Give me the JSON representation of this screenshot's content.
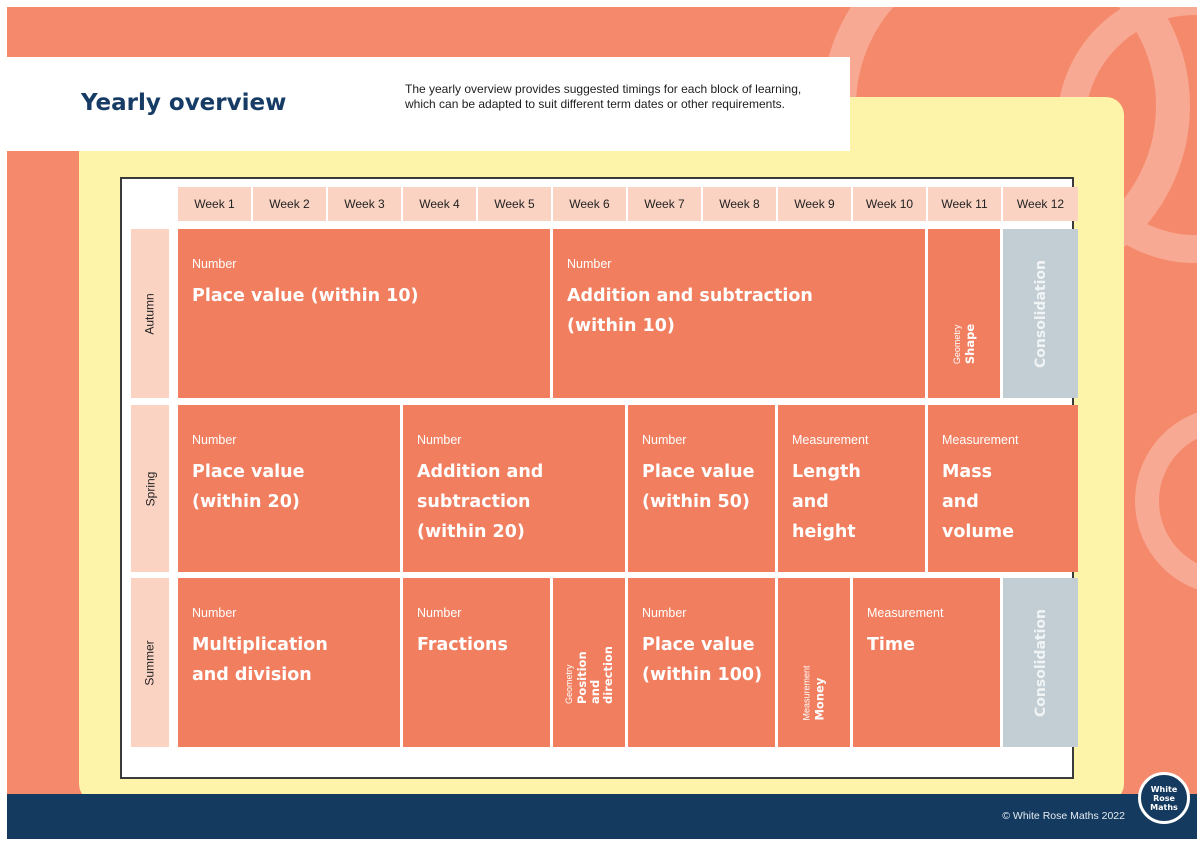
{
  "header": {
    "title": "Yearly overview",
    "intro": "The yearly overview provides suggested timings for each block of learning, which can be adapted to suit different term dates or other requirements."
  },
  "weeks": [
    "Week 1",
    "Week 2",
    "Week 3",
    "Week 4",
    "Week 5",
    "Week 6",
    "Week 7",
    "Week 8",
    "Week 9",
    "Week 10",
    "Week 11",
    "Week 12"
  ],
  "terms": {
    "autumn": {
      "label": "Autumn",
      "blocks": [
        {
          "category": "Number",
          "name": "Place value (within 10)"
        },
        {
          "category": "Number",
          "name": "Addition and subtraction\n(within 10)"
        },
        {
          "category": "Geometry",
          "name": "Shape"
        },
        {
          "name": "Consolidation"
        }
      ]
    },
    "spring": {
      "label": "Spring",
      "blocks": [
        {
          "category": "Number",
          "name": "Place value\n(within 20)"
        },
        {
          "category": "Number",
          "name": "Addition and\nsubtraction\n(within 20)"
        },
        {
          "category": "Number",
          "name": "Place value\n(within 50)"
        },
        {
          "category": "Measurement",
          "name": "Length\nand\nheight"
        },
        {
          "category": "Measurement",
          "name": "Mass\nand\nvolume"
        }
      ]
    },
    "summer": {
      "label": "Summer",
      "blocks": [
        {
          "category": "Number",
          "name": "Multiplication\nand division"
        },
        {
          "category": "Number",
          "name": "Fractions"
        },
        {
          "category": "Geometry",
          "name": "Position and\ndirection"
        },
        {
          "category": "Number",
          "name": "Place value\n(within 100)"
        },
        {
          "category": "Measurement",
          "name": "Money"
        },
        {
          "category": "Measurement",
          "name": "Time"
        },
        {
          "name": "Consolidation"
        }
      ]
    }
  },
  "footer": {
    "copyright": "© White Rose Maths 2022",
    "logo_text": "White\nRose\nMaths"
  },
  "colors": {
    "background": "#f5896b",
    "block": "#f07e5f",
    "header_cell": "#fbd3c3",
    "consolidation": "#c3ced4",
    "panel": "#fdf3a9",
    "footer": "#143a60"
  }
}
